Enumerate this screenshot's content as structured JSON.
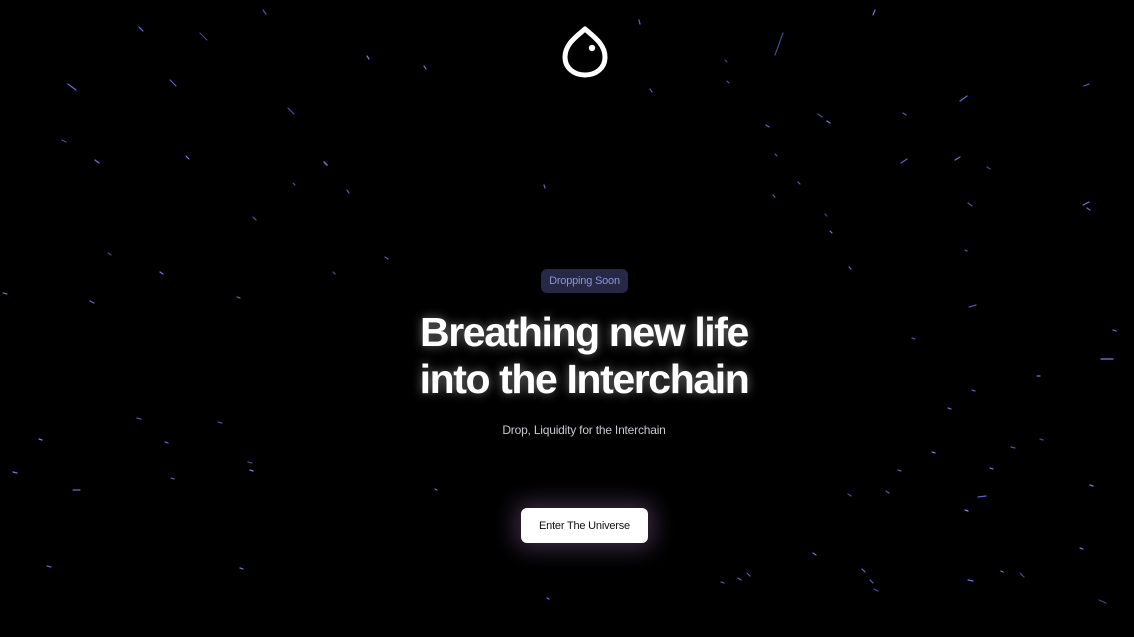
{
  "hero": {
    "badge_label": "Dropping Soon",
    "headline_line1": "Breathing new life",
    "headline_line2": "into the Interchain",
    "subtitle": "Drop, Liquidity for the Interchain",
    "cta_label": "Enter The Universe"
  },
  "colors": {
    "background": "#000000",
    "star": "#7b80ff",
    "badge_bg": "#262845",
    "badge_text": "#8e93d6",
    "cta_bg": "#ffffff",
    "cta_glow": "#c496e6"
  },
  "icons": {
    "logo": "drop-logo-icon"
  }
}
